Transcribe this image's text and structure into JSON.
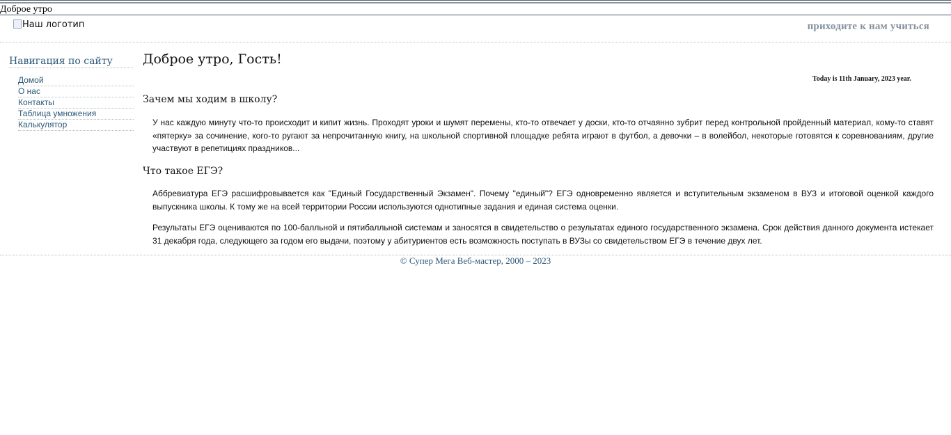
{
  "greeting_bar": {
    "text": "Доброе утро"
  },
  "header": {
    "logo_alt": "Наш логотип",
    "slogan": "приходите к нам учиться"
  },
  "nav": {
    "title": "Навигация по сайту",
    "items": [
      {
        "label": "Домой"
      },
      {
        "label": "О нас"
      },
      {
        "label": "Контакты"
      },
      {
        "label": "Таблица умножения"
      },
      {
        "label": "Калькулятор"
      }
    ]
  },
  "main": {
    "title": "Доброе утро, Гость!",
    "date": "Today is 11th January, 2023 year.",
    "sections": [
      {
        "heading": "Зачем мы ходим в школу?",
        "paragraphs": [
          "У нас каждую минуту что-то происходит и кипит жизнь. Проходят уроки и шумят перемены, кто-то отвечает у доски, кто-то отчаянно зубрит перед контрольной пройденный материал, кому-то ставят «пятерку» за сочинение, кого-то ругают за непрочитанную книгу, на школьной спортивной площадке ребята играют в футбол, а девочки – в волейбол, некоторые готовятся к соревнованиям, другие участвуют в репетициях праздников..."
        ]
      },
      {
        "heading": "Что такое ЕГЭ?",
        "paragraphs": [
          "Аббревиатура ЕГЭ расшифровывается как \"Единый Государственный Экзамен\". Почему \"единый\"? ЕГЭ одновременно является и вступительным экзаменом в ВУЗ и итоговой оценкой каждого выпускника школы. К тому же на всей территории России используются однотипные задания и единая система оценки.",
          "Результаты ЕГЭ оцениваются по 100-балльной и пятибалльной системам и заносятся в свидетельство о результатах единого государственного экзамена. Срок действия данного документа истекает 31 декабря года, следующего за годом его выдачи, поэтому у абитуриентов есть возможность поступать в ВУЗы со свидетельством ЕГЭ в течение двух лет."
        ]
      }
    ]
  },
  "footer": {
    "text": "© Супер Мега Веб-мастер, 2000 – 2023"
  }
}
